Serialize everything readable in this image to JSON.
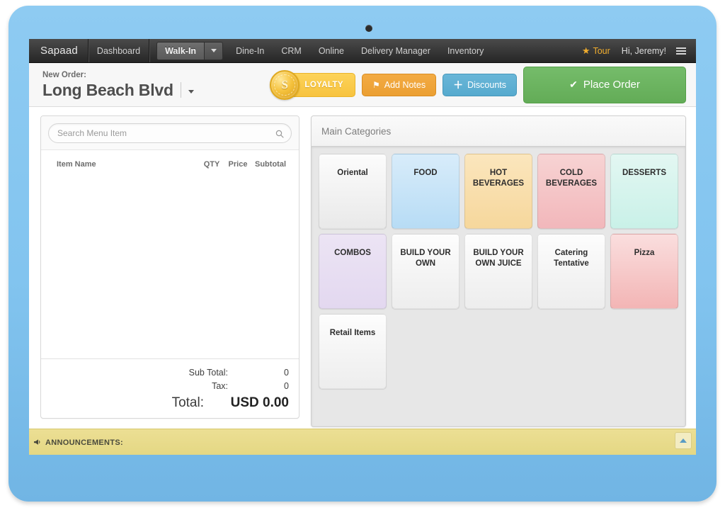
{
  "navbar": {
    "brand": "Sapaad",
    "dashboard": "Dashboard",
    "order_type": "Walk-In",
    "items": [
      {
        "label": "Dine-In"
      },
      {
        "label": "CRM"
      },
      {
        "label": "Online"
      },
      {
        "label": "Delivery Manager"
      },
      {
        "label": "Inventory"
      }
    ],
    "tour": "Tour",
    "greeting": "Hi, Jeremy!",
    "star_icon": "★",
    "menu_icon": "hamburger-icon"
  },
  "order_header": {
    "new_order_label": "New Order:",
    "location": "Long Beach Blvd",
    "loyalty_label": "LOYALTY",
    "loyalty_coin_letter": "S",
    "add_notes_label": "Add Notes",
    "discounts_label": "Discounts",
    "place_order_label": "Place Order",
    "tag_icon": "⚑",
    "plus_icon": "＋",
    "check_icon": "✔"
  },
  "order_panel": {
    "search_placeholder": "Search Menu Item",
    "search_value": "",
    "columns": {
      "item_name": "Item Name",
      "qty": "QTY",
      "price": "Price",
      "subtotal": "Subtotal"
    },
    "rows": [],
    "totals": {
      "sub_total_label": "Sub Total:",
      "sub_total_value": "0",
      "tax_label": "Tax:",
      "tax_value": "0",
      "total_label": "Total:",
      "total_value": "USD 0.00"
    }
  },
  "categories": {
    "panel_title": "Main Categories",
    "tiles": [
      {
        "label": "Oriental",
        "bg_top": "#fcfcfc",
        "bg_bottom": "#e9e9e9"
      },
      {
        "label": "FOOD",
        "bg_top": "#d8ecfa",
        "bg_bottom": "#b7dcf5"
      },
      {
        "label": "HOT BEVERAGES",
        "bg_top": "#fbe6bd",
        "bg_bottom": "#f6d79c"
      },
      {
        "label": "COLD BEVERAGES",
        "bg_top": "#f7d3d3",
        "bg_bottom": "#f2b7bb"
      },
      {
        "label": "DESSERTS",
        "bg_top": "#e3f7f2",
        "bg_bottom": "#c9f1e8"
      },
      {
        "label": "COMBOS",
        "bg_top": "#ece4f4",
        "bg_bottom": "#e3d8f0"
      },
      {
        "label": "BUILD YOUR OWN",
        "bg_top": "#fdfdfd",
        "bg_bottom": "#ededed"
      },
      {
        "label": "BUILD YOUR OWN JUICE",
        "bg_top": "#fdfdfd",
        "bg_bottom": "#ededed"
      },
      {
        "label": "Catering Tentative",
        "bg_top": "#fdfdfd",
        "bg_bottom": "#ededed"
      },
      {
        "label": "Pizza",
        "bg_top": "#fadede",
        "bg_bottom": "#f3b5b5"
      },
      {
        "label": "Retail Items",
        "bg_top": "#fdfdfd",
        "bg_bottom": "#ededed"
      }
    ]
  },
  "announcements": {
    "label": "ANNOUNCEMENTS:",
    "megaphone_icon": "📢",
    "collapse_icon": "chevron-up-icon"
  },
  "colors": {
    "tablet_frame": "#82c4ef",
    "navbar": "#333333",
    "place_order_green": "#63ac57",
    "notes_orange": "#eb9f32",
    "discount_blue": "#56aace",
    "loyalty_gold": "#f7c33f",
    "announcement_yellow": "#e4d783"
  }
}
